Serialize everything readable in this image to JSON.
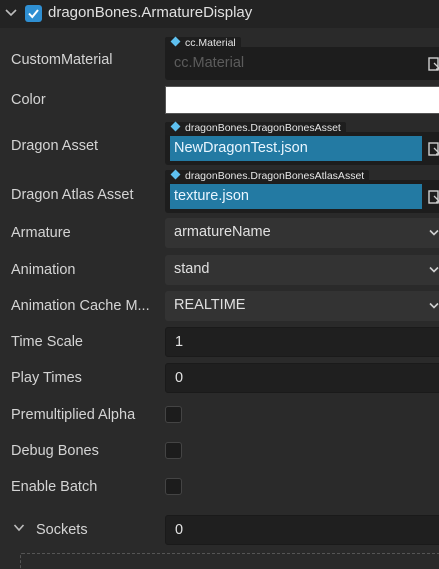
{
  "header": {
    "title": "dragonBones.ArmatureDisplay",
    "enabled": true
  },
  "properties": {
    "custom_material": {
      "label": "CustomMaterial",
      "type_tag": "cc.Material",
      "value": "cc.Material"
    },
    "color": {
      "label": "Color",
      "value": "#ffffff"
    },
    "dragon_asset": {
      "label": "Dragon Asset",
      "type_tag": "dragonBones.DragonBonesAsset",
      "value": "NewDragonTest.json"
    },
    "dragon_atlas_asset": {
      "label": "Dragon Atlas Asset",
      "type_tag": "dragonBones.DragonBonesAtlasAsset",
      "value": "texture.json"
    },
    "armature": {
      "label": "Armature",
      "value": "armatureName"
    },
    "animation": {
      "label": "Animation",
      "value": "stand"
    },
    "animation_cache_mode": {
      "label": "Animation Cache M...",
      "value": "REALTIME"
    },
    "time_scale": {
      "label": "Time Scale",
      "value": "1"
    },
    "play_times": {
      "label": "Play Times",
      "value": "0"
    },
    "premultiplied_alpha": {
      "label": "Premultiplied Alpha",
      "checked": false
    },
    "debug_bones": {
      "label": "Debug Bones",
      "checked": false
    },
    "enable_batch": {
      "label": "Enable Batch",
      "checked": false
    },
    "sockets": {
      "label": "Sockets",
      "value": "0"
    }
  },
  "colors": {
    "accent_blue": "#2f8fd2",
    "asset_highlight": "#237aa3",
    "panel_bg": "#2a2a2a"
  }
}
